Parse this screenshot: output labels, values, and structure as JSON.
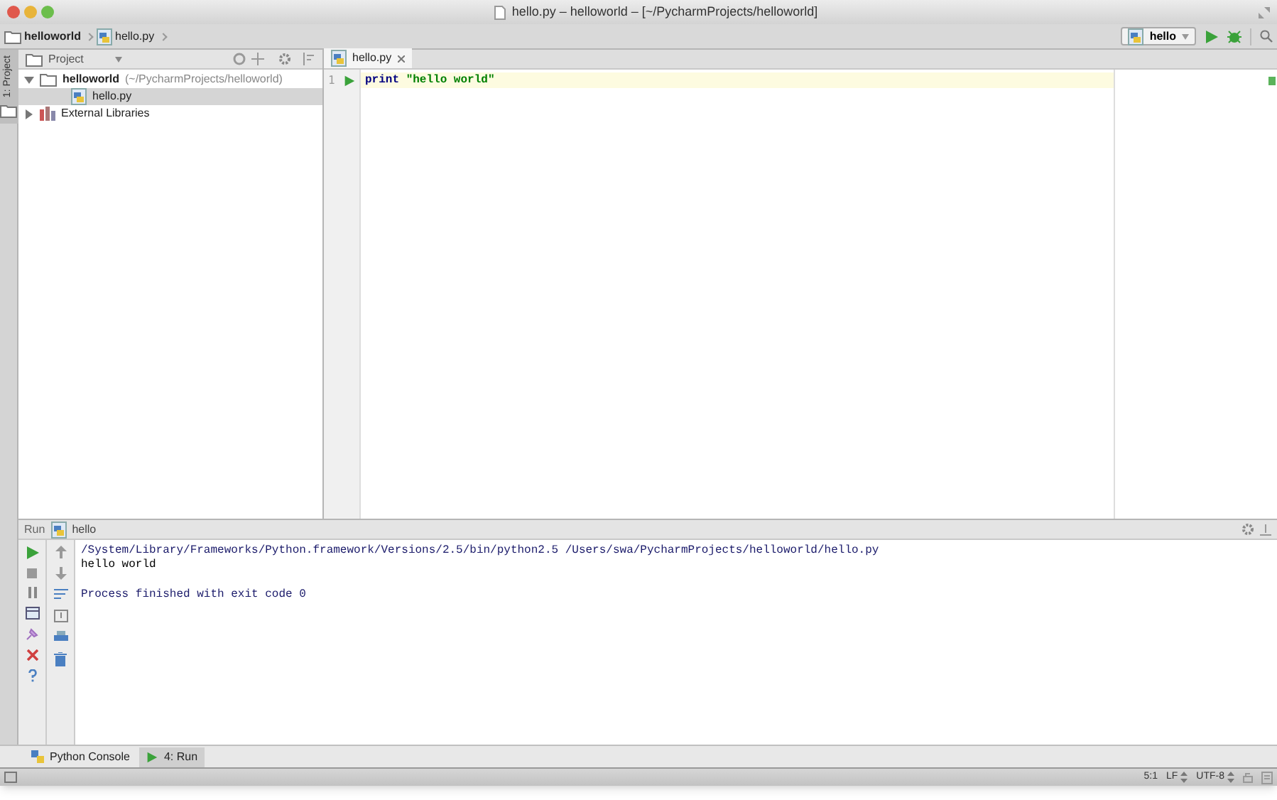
{
  "window": {
    "title": "hello.py – helloworld – [~/PycharmProjects/helloworld]"
  },
  "breadcrumbs": [
    "helloworld",
    "hello.py"
  ],
  "toolbar": {
    "run_config": "hello"
  },
  "side_tab": {
    "label": "1: Project",
    "selected": true
  },
  "project_panel": {
    "title": "Project",
    "tree": [
      {
        "label": "helloworld",
        "path": "(~/PycharmProjects/helloworld)",
        "kind": "folder",
        "expanded": true,
        "selected": false,
        "children": [
          {
            "label": "hello.py",
            "kind": "file",
            "selected": true
          }
        ]
      },
      {
        "label": "External Libraries",
        "kind": "library",
        "expanded": false,
        "selected": false
      }
    ]
  },
  "editor": {
    "tabs": [
      {
        "label": "hello.py",
        "selected": true
      }
    ],
    "lines": [
      {
        "number": "1",
        "tokens": [
          {
            "kind": "keyword",
            "text": "print"
          },
          {
            "kind": "string",
            "text": "\"hello world\""
          }
        ]
      }
    ]
  },
  "run_panel": {
    "title": "Run",
    "config": "hello",
    "output": [
      {
        "kind": "command",
        "text": "/System/Library/Frameworks/Python.framework/Versions/2.5/bin/python2.5 /Users/swa/PycharmProjects/helloworld/hello.py"
      },
      {
        "kind": "stdout",
        "text": "hello world"
      },
      {
        "kind": "info",
        "text": "Process finished with exit code 0"
      }
    ]
  },
  "bottom_tabs": [
    {
      "label": "Python Console",
      "kind": "console",
      "selected": false
    },
    {
      "label": "4: Run",
      "kind": "run",
      "selected": true
    }
  ],
  "status_bar": {
    "position": "5:1",
    "line_separator": "LF",
    "encoding": "UTF-8"
  }
}
